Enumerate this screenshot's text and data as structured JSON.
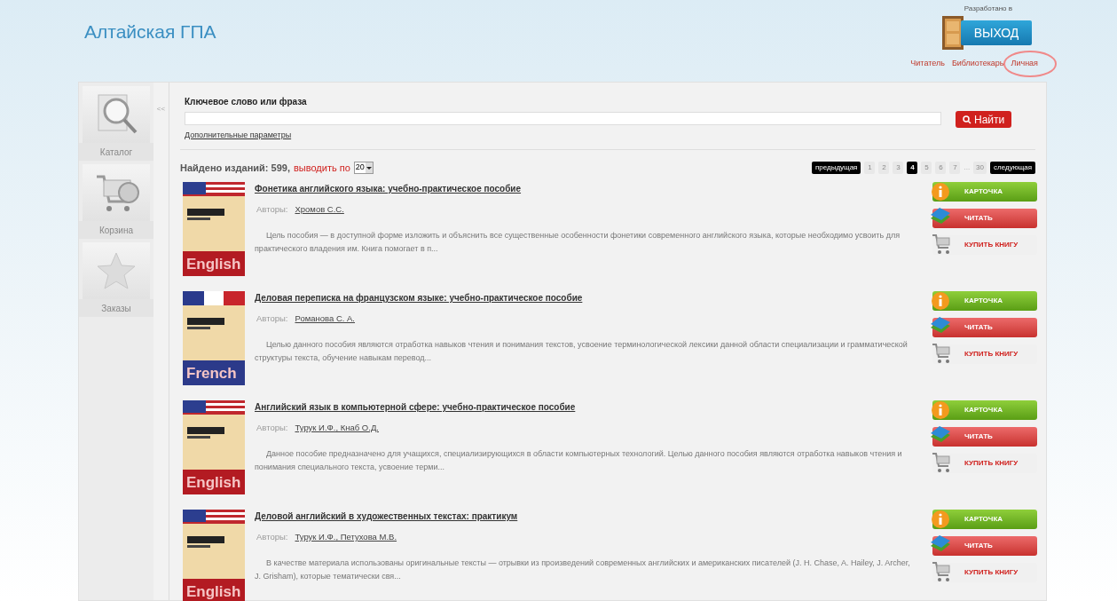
{
  "header": {
    "title": "Алтайская ГПА",
    "developed_by": "Разработано в",
    "exit_button": "ВЫХОД",
    "links": [
      {
        "label": "Читатель",
        "highlighted": false
      },
      {
        "label": "Библиотекарь",
        "highlighted": false
      },
      {
        "label": "Личная",
        "highlighted": true
      }
    ]
  },
  "sidebar": {
    "items": [
      {
        "kind": "catalog",
        "label": "Каталог"
      },
      {
        "kind": "cart",
        "label": "Корзина"
      },
      {
        "kind": "orders",
        "label": "Заказы"
      }
    ],
    "collapse": "<<"
  },
  "search": {
    "label": "Ключевое слово или фраза",
    "button": "Найти",
    "advanced_link": "Дополнительные параметры"
  },
  "results": {
    "found": "Найдено изданий: 599,",
    "per_page_label": "выводить по",
    "per_page": "20"
  },
  "pagination": [
    {
      "label": "предыдущая",
      "kind": "nav"
    },
    {
      "label": "1",
      "kind": "page",
      "selected": false
    },
    {
      "label": "2",
      "kind": "page",
      "selected": false
    },
    {
      "label": "3",
      "kind": "page",
      "selected": false
    },
    {
      "label": "4",
      "kind": "page",
      "selected": true
    },
    {
      "label": "5",
      "kind": "page",
      "selected": false
    },
    {
      "label": "6",
      "kind": "page",
      "selected": false
    },
    {
      "label": "7",
      "kind": "page",
      "selected": false
    },
    {
      "label": "...",
      "kind": "gap"
    },
    {
      "label": "30",
      "kind": "page",
      "selected": false
    },
    {
      "label": "следующая",
      "kind": "nav"
    }
  ],
  "books": [
    {
      "kind": "us-flag",
      "cover_label": "English",
      "title": "Фонетика английского языка: учебно-практическое пособие",
      "authors_label": "Авторы:",
      "authors": "Хромов С.С.",
      "description": "Цель пособия — в доступной форме изложить и объяснить все существенные особенности фонетики современного английского языка, которые необходимо усвоить для практического владения им. Книга помогает в п...",
      "buttons": [
        "КАРТОЧКА",
        "ЧИТАТЬ",
        "КУПИТЬ КНИГУ"
      ]
    },
    {
      "kind": "french-flag",
      "cover_label": "French",
      "title": "Деловая переписка на французском языке: учебно-практическое пособие",
      "authors_label": "Авторы:",
      "authors": "Романова С. А.",
      "description": "Целью данного пособия являются отработка навыков чтения и понимания текстов, усвоение терминологической лексики данной области специализации и грамматической структуры текста, обучение навыкам перевод...",
      "buttons": [
        "КАРТОЧКА",
        "ЧИТАТЬ",
        "КУПИТЬ КНИГУ"
      ]
    },
    {
      "kind": "us-flag",
      "cover_label": "English",
      "title": "Английский язык в компьютерной сфере: учебно-практическое пособие",
      "authors_label": "Авторы:",
      "authors": "Турук И.Ф., Кнаб О.Д.",
      "description": "Данное пособие предназначено для учащихся, специализирующихся в области компьютерных технологий. Целью данного пособия являются отработка навыков чтения и понимания специального текста, усвоение терми...",
      "buttons": [
        "КАРТОЧКА",
        "ЧИТАТЬ",
        "КУПИТЬ КНИГУ"
      ]
    },
    {
      "kind": "us-flag",
      "cover_label": "English",
      "title": "Деловой английский в художественных текстах: практикум",
      "authors_label": "Авторы:",
      "authors": "Турук И.Ф., Петухова М.В.",
      "description": "В качестве материала использованы оригинальные тексты — отрывки из произведений современных английских и американских писателей (J. H. Chase, A. Hailey, J. Archer, J. Grisham), которые тематически свя...",
      "buttons": [
        "КАРТОЧКА",
        "ЧИТАТЬ",
        "КУПИТЬ КНИГУ"
      ]
    }
  ]
}
